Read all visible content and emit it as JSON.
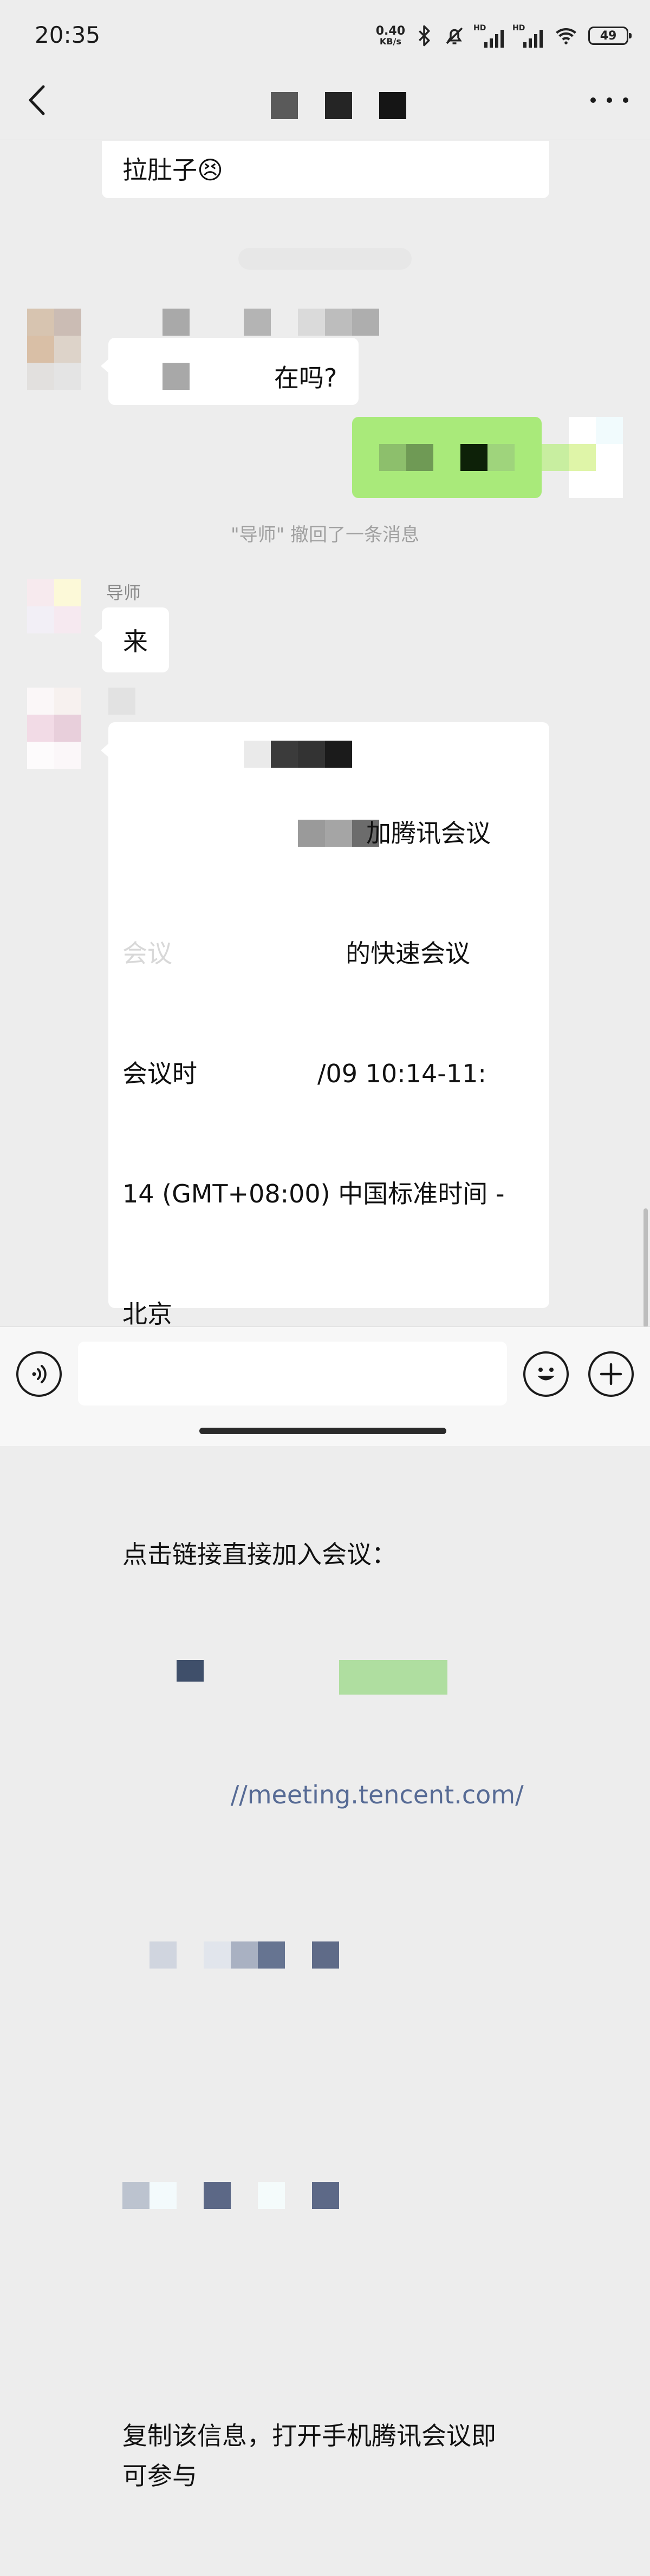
{
  "status_bar": {
    "time": "20:35",
    "net_speed_value": "0.40",
    "net_speed_unit": "KB/s",
    "hd_label_1": "HD",
    "hd_label_2": "HD",
    "battery": "49"
  },
  "chat_header": {
    "back_icon": "chevron-left-icon",
    "more_icon": "ellipsis-icon"
  },
  "messages": {
    "m1_text": "拉肚子😣",
    "m2_text": "在吗?",
    "recall_notice": "\"导师\" 撤回了一条消息",
    "m4_sender": "导师",
    "m4_text": "来",
    "meeting": {
      "line1": "加腾讯会议",
      "line2": "的快速会议",
      "line3_prefix": "会议时",
      "line3_suffix": "/09 10:14-11:",
      "line4": "14 (GMT+08:00) 中国标准时间 -",
      "line5": "北京",
      "join_label": "点击链接直接加入会议：",
      "link": "//meeting.tencent.com/",
      "footer": "复制该信息，打开手机腾讯会议即\n可参与"
    }
  },
  "input_bar": {
    "voice_icon": "voice-icon",
    "emoji_icon": "emoji-icon",
    "plus_icon": "plus-icon",
    "input_value": ""
  },
  "colors": {
    "background": "#ededed",
    "sent_bubble": "#a9ea7a",
    "received_bubble": "#ffffff"
  }
}
